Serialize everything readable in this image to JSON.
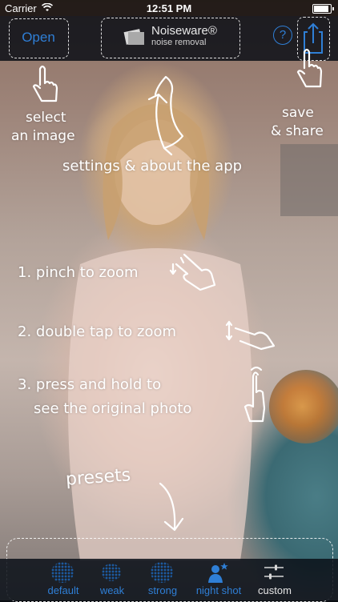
{
  "status_bar": {
    "carrier": "Carrier",
    "time": "12:51 PM"
  },
  "header": {
    "open_label": "Open",
    "logo_name": "Noiseware®",
    "logo_sub": "noise removal",
    "help_label": "?"
  },
  "hints": {
    "select": [
      "select",
      "an image"
    ],
    "save": [
      "save",
      "& share"
    ],
    "settings": "settings & about the app",
    "pinch": "1. pinch to zoom",
    "double_tap": "2. double tap to zoom",
    "press": [
      "3. press and hold to",
      "see the original photo"
    ],
    "presets": "presets"
  },
  "presets": [
    {
      "label": "default",
      "icon": "dots-icon"
    },
    {
      "label": "weak",
      "icon": "dots-icon"
    },
    {
      "label": "strong",
      "icon": "dots-icon"
    },
    {
      "label": "night shot",
      "icon": "person-star-icon"
    },
    {
      "label": "custom",
      "icon": "sliders-icon"
    }
  ],
  "colors": {
    "accent": "#2f7fd6",
    "bar": "#0a1018",
    "hint": "#ffffff"
  }
}
